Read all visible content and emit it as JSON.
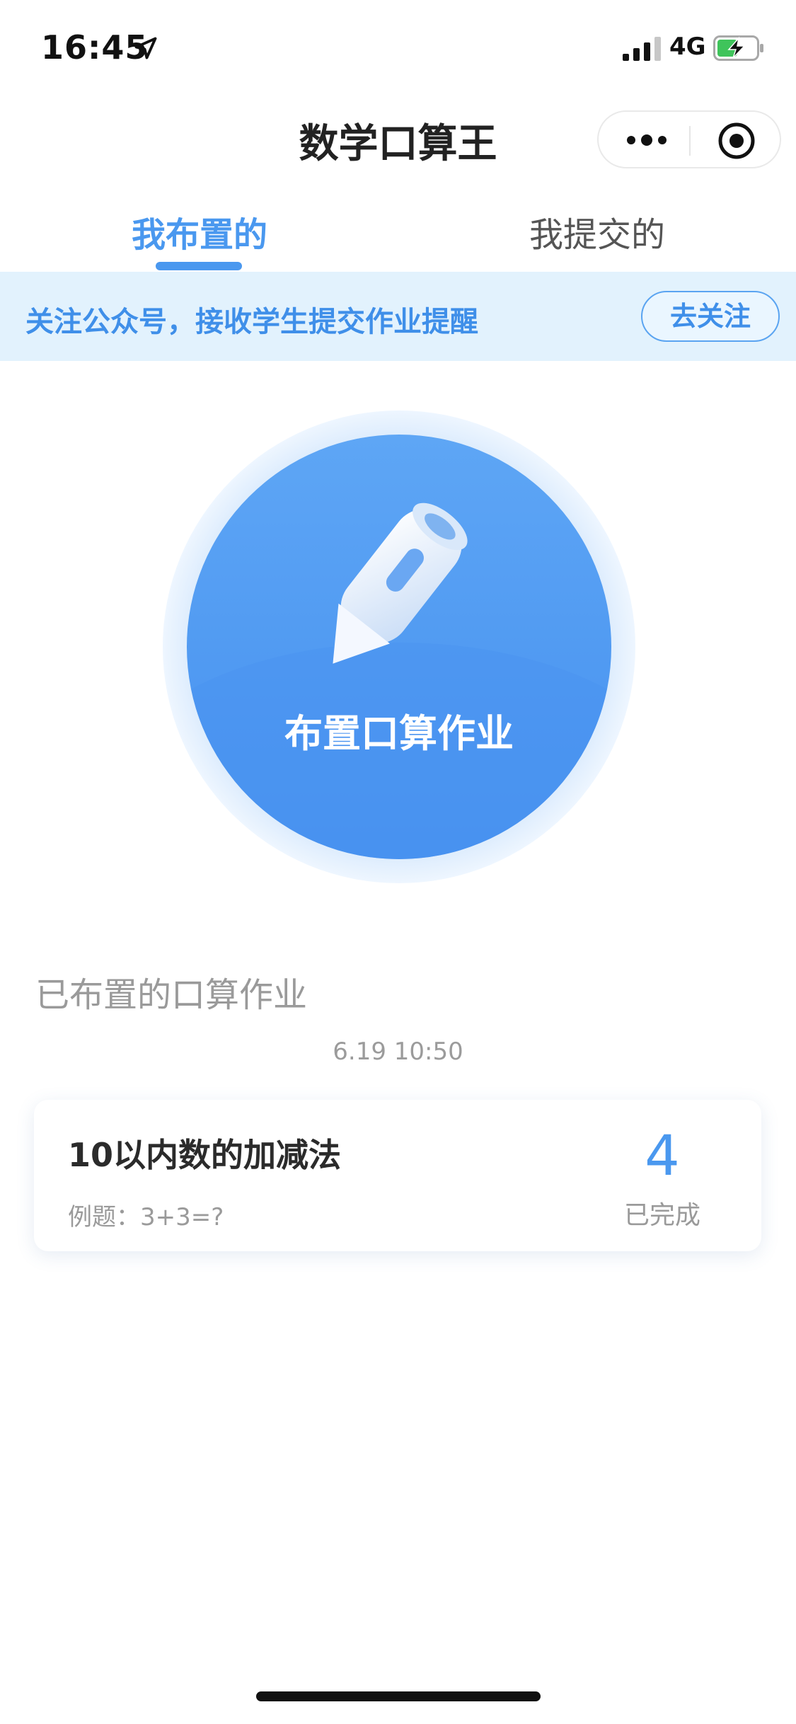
{
  "status_bar": {
    "time": "16:45",
    "network": "4G",
    "icons": [
      "location-arrow-icon",
      "signal-icon",
      "battery-charging-icon"
    ]
  },
  "nav": {
    "title": "数学口算王",
    "capsule_icons": [
      "more-dots-icon",
      "target-icon"
    ]
  },
  "tabs": [
    {
      "label": "我布置的",
      "active": true
    },
    {
      "label": "我提交的",
      "active": false
    }
  ],
  "notice": {
    "text": "关注公众号，接收学生提交作业提醒",
    "button": "去关注"
  },
  "hero": {
    "label": "布置口算作业",
    "icon": "pencil-icon"
  },
  "assigned": {
    "section_title": "已布置的口算作业",
    "timestamp": "6.19 10:50",
    "items": [
      {
        "title": "10以内数的加减法",
        "example": "例题：3+3=?",
        "completed_count": "4",
        "completed_label": "已完成"
      }
    ]
  },
  "colors": {
    "accent": "#4a98ef",
    "notice_bg": "#e2f2fd",
    "circle_outer": "#dbeafb",
    "circle_inner": "#4b97f2"
  }
}
